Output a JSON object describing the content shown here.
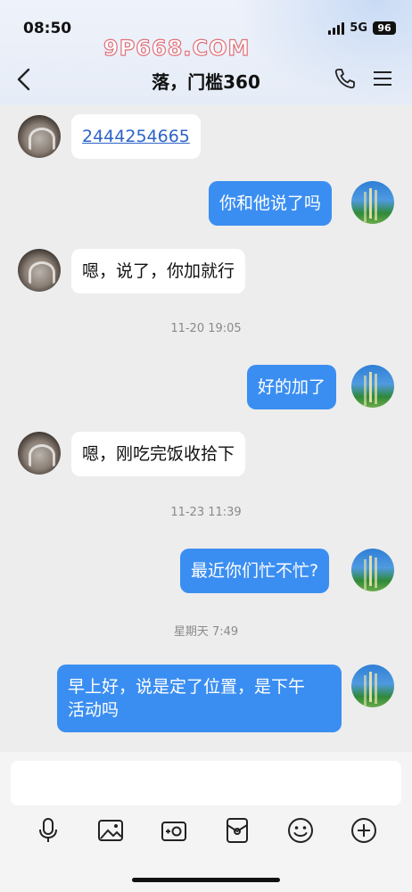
{
  "status_bar": {
    "time": "08:50",
    "network": "5G",
    "battery": "96"
  },
  "watermark": {
    "text": "9P668.COM"
  },
  "header": {
    "title": "落，门槛360"
  },
  "messages": [
    {
      "side": "left",
      "text": "2444254665",
      "is_link": true
    },
    {
      "side": "right",
      "text": "你和他说了吗"
    },
    {
      "side": "left",
      "text": "嗯，说了，你加就行"
    },
    {
      "timestamp": "11-20 19:05"
    },
    {
      "side": "right",
      "text": "好的加了"
    },
    {
      "side": "left",
      "text": "嗯，刚吃完饭收拾下"
    },
    {
      "timestamp": "11-23 11:39"
    },
    {
      "side": "right",
      "text": "最近你们忙不忙?"
    },
    {
      "timestamp": "星期天 7:49"
    },
    {
      "side": "right",
      "text_line1": "早上好，说是定了位置，是下午",
      "text_line2": "活动吗"
    }
  ],
  "toolbar": {
    "icons": [
      "microphone-icon",
      "image-icon",
      "camera-icon",
      "red-packet-icon",
      "emoji-icon",
      "plus-icon"
    ]
  },
  "colors": {
    "accent": "#3b8ef1",
    "link": "#2d63c8",
    "background": "#ededed"
  }
}
